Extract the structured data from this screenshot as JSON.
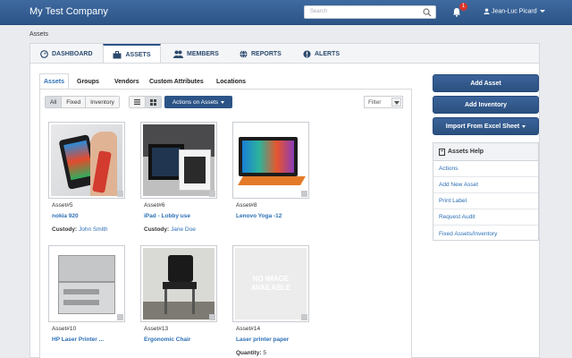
{
  "header": {
    "company": "My Test Company",
    "search_placeholder": "Search",
    "notification_count": "1",
    "user_name": "Jean-Luc Picard"
  },
  "breadcrumb": "Assets",
  "nav": {
    "tabs": [
      {
        "label": "DASHBOARD",
        "icon": "dashboard-icon"
      },
      {
        "label": "ASSETS",
        "icon": "briefcase-icon"
      },
      {
        "label": "MEMBERS",
        "icon": "users-icon"
      },
      {
        "label": "REPORTS",
        "icon": "globe-icon"
      },
      {
        "label": "ALERTS",
        "icon": "alert-icon"
      }
    ],
    "active": "ASSETS"
  },
  "subtabs": [
    "Assets",
    "Groups",
    "Vendors",
    "Custom Attributes",
    "Locations"
  ],
  "toolbar": {
    "filter_buttons": [
      "All",
      "Fixed",
      "Inventory"
    ],
    "actions_label": "Actions on Assets",
    "filter_label": "Filter"
  },
  "assets": [
    {
      "id": "Asset#5",
      "name": "nokia 920",
      "meta_label": "Custody:",
      "meta_value": "John Smith"
    },
    {
      "id": "Asset#6",
      "name": "iPad - Lobby use",
      "meta_label": "Custody:",
      "meta_value": "Jane Doe"
    },
    {
      "id": "Asset#8",
      "name": "Lenovo Yoga -12",
      "meta_label": "",
      "meta_value": ""
    },
    {
      "id": "Asset#10",
      "name": "HP Laser Printer ...",
      "meta_label": "",
      "meta_value": ""
    },
    {
      "id": "Asset#13",
      "name": "Ergonomic Chair",
      "meta_label": "",
      "meta_value": ""
    },
    {
      "id": "Asset#14",
      "name": "Laser printer paper",
      "meta_label": "Quantity:",
      "meta_value": "5",
      "no_image_text": "NO IMAGE AVAILABLE"
    }
  ],
  "sidebar": {
    "add_asset": "Add Asset",
    "add_inventory": "Add Inventory",
    "import_label": "Import From Excel Sheet",
    "help_title": "Assets Help",
    "help_items": [
      "Actions",
      "Add New Asset",
      "Print Label",
      "Request Audit",
      "Fixed Assets/Inventory"
    ]
  },
  "colors": {
    "brand": "#2c5487",
    "link": "#2c6fb5",
    "badge": "#d9342b"
  }
}
